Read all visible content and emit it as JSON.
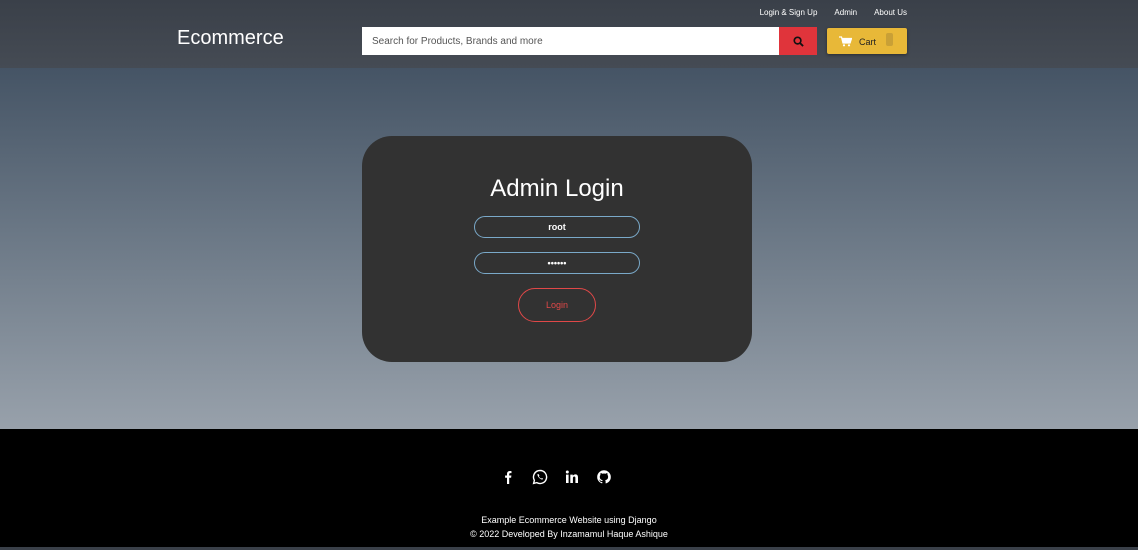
{
  "header": {
    "brand": "Ecommerce",
    "top_links": [
      "Login & Sign Up",
      "Admin",
      "About Us"
    ],
    "search_placeholder": "Search for Products, Brands and more",
    "search_icon": "search-icon",
    "cart_label": "Cart",
    "cart_icon": "cart-icon"
  },
  "login": {
    "title": "Admin Login",
    "username_value": "root",
    "password_value": "••••••",
    "button_label": "Login"
  },
  "footer": {
    "social_icons": [
      "facebook-icon",
      "whatsapp-icon",
      "linkedin-icon",
      "github-icon"
    ],
    "line1": "Example Ecommerce Website using Django",
    "line2": "© 2022 Developed By Inzamamul Haque Ashique"
  },
  "colors": {
    "header_bg": "#3f454e",
    "search_button": "#e0343b",
    "cart_button": "#e8b838",
    "card_bg": "#323232",
    "input_border": "#7aa9c9",
    "login_button": "#e04848",
    "footer_bg": "#000000"
  }
}
